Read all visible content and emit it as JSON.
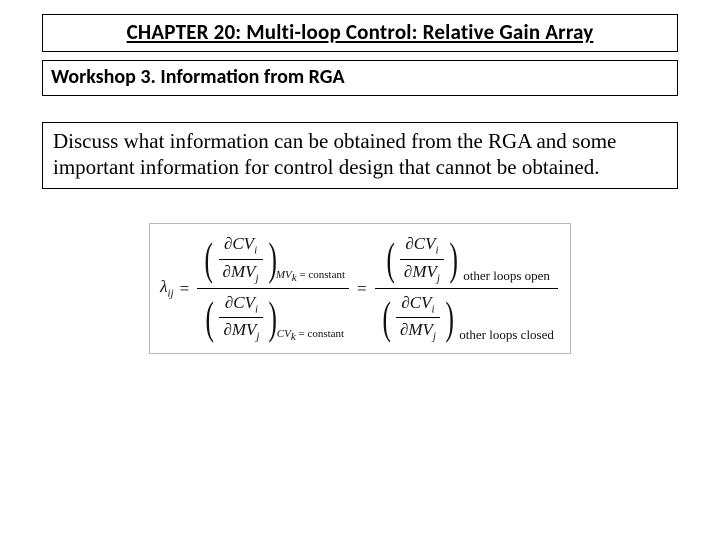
{
  "title": "CHAPTER 20: Multi-loop Control: Relative Gain Array",
  "subtitle": "Workshop 3. Information from RGA",
  "body": "Discuss what information can be obtained from the RGA and some important information for control design that cannot be obtained.",
  "equation": {
    "lambda": "λ",
    "lambda_sub": "ij",
    "eq": "=",
    "partial": "∂",
    "cv": "CV",
    "mv": "MV",
    "i": "i",
    "j": "j",
    "k": "k",
    "cond_mv": " = constant",
    "cond_cv": " = constant",
    "words_open": "other loops open",
    "words_closed": "other loops closed"
  }
}
